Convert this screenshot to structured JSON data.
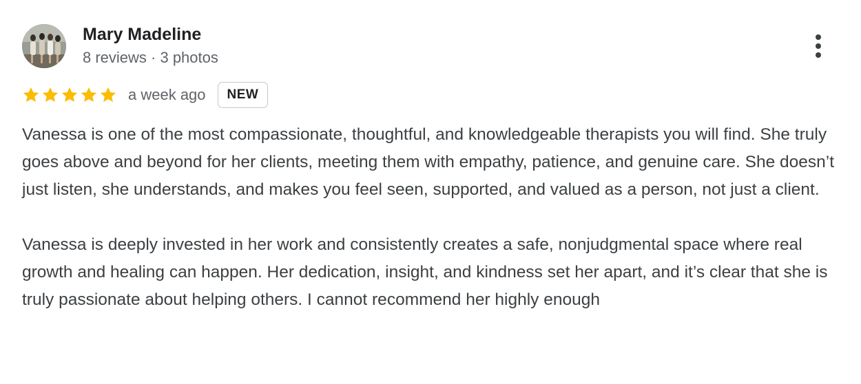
{
  "author": {
    "name": "Mary Madeline",
    "meta": "8 reviews · 3 photos"
  },
  "review": {
    "rating": 5,
    "rating_max": 5,
    "time": "a week ago",
    "badge": "NEW",
    "paragraphs": [
      "Vanessa is one of the most compassionate, thoughtful, and knowledgeable therapists you will find. She truly goes above and beyond for her clients, meeting them with empathy, patience, and genuine care. She doesn’t just listen, she understands, and makes you feel seen, supported, and valued as a person, not just a client.",
      "Vanessa is deeply invested in her work and consistently creates a safe, nonjudgmental space where real growth and healing can happen. Her dedication, insight, and kindness set her apart, and it’s clear that she is truly passionate about helping others. I cannot recommend her highly enough"
    ]
  },
  "icons": {
    "star": "star-icon",
    "more": "more-vert-icon"
  },
  "colors": {
    "star": "#fbbc04",
    "name": "#202124",
    "secondary": "#5f6368",
    "body_text": "#3c4043",
    "badge_border": "#c4c7c5"
  }
}
